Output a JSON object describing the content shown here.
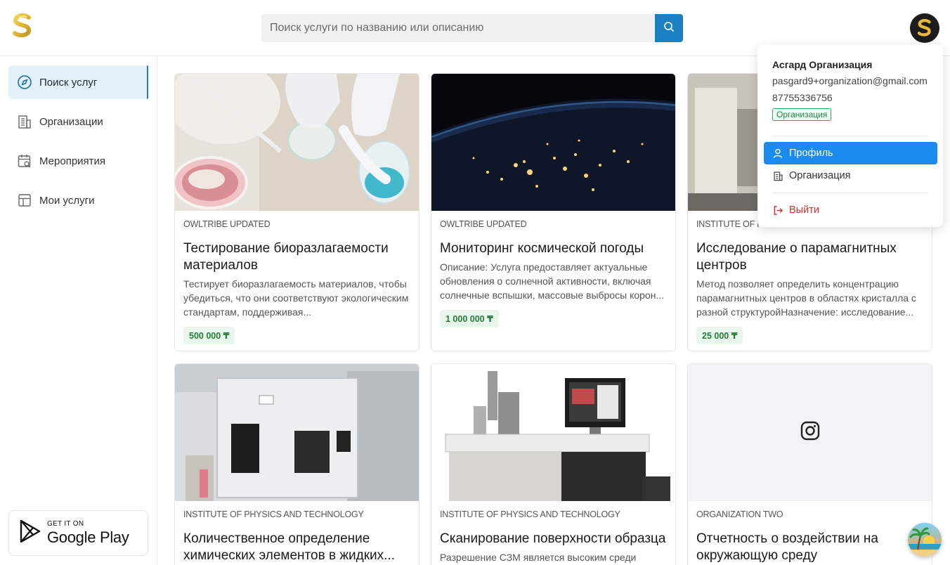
{
  "header": {
    "search_placeholder": "Поиск услуги по названию или описанию"
  },
  "sidebar": {
    "items": [
      {
        "label": "Поиск услуг",
        "icon": "compass-icon",
        "active": true
      },
      {
        "label": "Организации",
        "icon": "building-icon",
        "active": false
      },
      {
        "label": "Мероприятия",
        "icon": "calendar-search-icon",
        "active": false
      },
      {
        "label": "Мои услуги",
        "icon": "layout-icon",
        "active": false
      }
    ],
    "store_badge": {
      "small": "GET IT ON",
      "big": "Google Play",
      "icon": "google-play-icon"
    }
  },
  "cards": [
    {
      "org": "OWLTRIBE UPDATED",
      "title": "Тестирование биоразлагаемости материалов",
      "desc": "Тестирует биоразлагаемость материалов, чтобы убедиться, что они соответствуют экологическим стандартам, поддерживая...",
      "price": "500 000 ₸"
    },
    {
      "org": "OWLTRIBE UPDATED",
      "title": "Мониторинг космической погоды",
      "desc": "Описание: Услуга предоставляет актуальные обновления о солнечной активности, включая солнечные вспышки, массовые выбросы корон...",
      "price": "1 000 000 ₸"
    },
    {
      "org": "INSTITUTE OF PHYSICS AND TECHNOLOGY",
      "title": "Исследование о парамагнитных центров",
      "desc": "Метод позволяет определить концентрацию парамагнитных центров в областях кристалла с разной структуройНазначение: исследование...",
      "price": "25 000 ₸"
    },
    {
      "org": "INSTITUTE OF PHYSICS AND TECHNOLOGY",
      "title": "Количественное определение химических элементов в жидких...",
      "desc": "",
      "price": ""
    },
    {
      "org": "INSTITUTE OF PHYSICS AND TECHNOLOGY",
      "title": "Сканирование поверхности образца",
      "desc": "Разрешение СЗМ является высоким среди",
      "price": ""
    },
    {
      "org": "ORGANIZATION TWO",
      "title": "Отчетность о воздействии на окружающую среду",
      "desc": "",
      "price": ""
    }
  ],
  "user_menu": {
    "name": "Асгард Организация",
    "email": "pasgard9+organization@gmail.com",
    "phone": "87755336756",
    "role_badge": "Организация",
    "items": [
      {
        "label": "Профиль",
        "icon": "user-icon"
      },
      {
        "label": "Организация",
        "icon": "building-icon"
      },
      {
        "label": "Выйти",
        "icon": "logout-icon"
      }
    ]
  },
  "colors": {
    "accent": "#1a80c4",
    "menu_active": "#1a8cf0",
    "price_bg": "#e8f6ec",
    "price_text": "#267a3b",
    "logout": "#d0302f"
  }
}
